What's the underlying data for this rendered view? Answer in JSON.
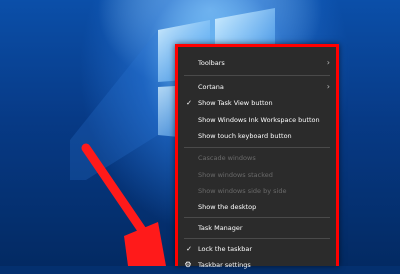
{
  "context_menu": {
    "items": [
      {
        "label": "Toolbars",
        "submenu": true,
        "checked": false,
        "disabled": false
      },
      {
        "label": "Cortana",
        "submenu": true,
        "checked": false,
        "disabled": false
      },
      {
        "label": "Show Task View button",
        "submenu": false,
        "checked": true,
        "disabled": false
      },
      {
        "label": "Show Windows Ink Workspace button",
        "submenu": false,
        "checked": false,
        "disabled": false
      },
      {
        "label": "Show touch keyboard button",
        "submenu": false,
        "checked": false,
        "disabled": false
      },
      {
        "label": "Cascade windows",
        "submenu": false,
        "checked": false,
        "disabled": true
      },
      {
        "label": "Show windows stacked",
        "submenu": false,
        "checked": false,
        "disabled": true
      },
      {
        "label": "Show windows side by side",
        "submenu": false,
        "checked": false,
        "disabled": true
      },
      {
        "label": "Show the desktop",
        "submenu": false,
        "checked": false,
        "disabled": false
      },
      {
        "label": "Task Manager",
        "submenu": false,
        "checked": false,
        "disabled": false
      },
      {
        "label": "Lock the taskbar",
        "submenu": false,
        "checked": true,
        "disabled": false
      },
      {
        "label": "Taskbar settings",
        "submenu": false,
        "checked": false,
        "disabled": false,
        "icon": "gear-icon"
      }
    ]
  },
  "colors": {
    "highlight_border": "#ff0000",
    "annotation_arrow": "#ff1a1a",
    "menu_background": "#2b2b2b"
  }
}
